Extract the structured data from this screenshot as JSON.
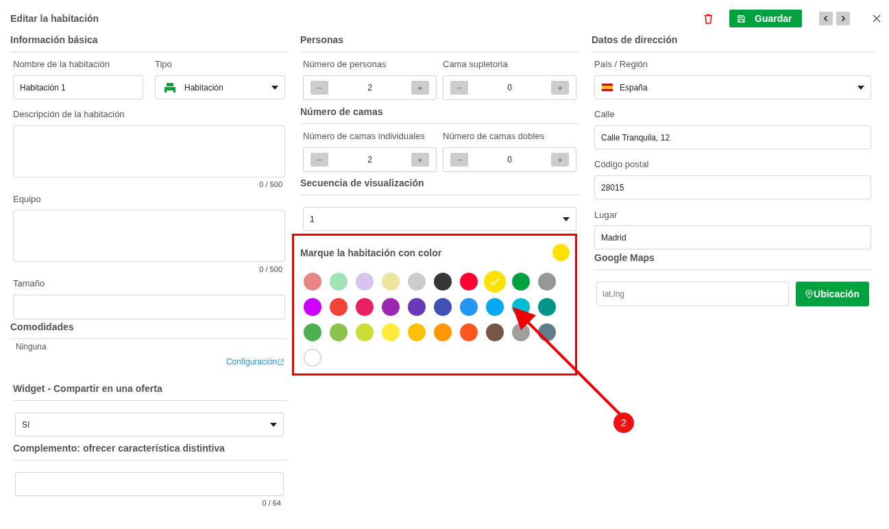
{
  "header": {
    "title": "Editar la habitación",
    "save_button": "Guardar"
  },
  "basic_info": {
    "heading": "Información básica",
    "name": {
      "label": "Nombre de la habitación",
      "value": "Habitación 1"
    },
    "type": {
      "label": "Tipo",
      "value": "Habitación"
    },
    "description": {
      "label": "Descripción de la habitación",
      "counter": "0 / 500"
    },
    "equipment": {
      "label": "Equipo",
      "counter": "0 / 500"
    },
    "size": {
      "label": "Tamaño"
    },
    "amenities": {
      "heading": "Comodidades",
      "value": "Ninguna",
      "link": "Configuración"
    },
    "widget": {
      "heading": "Widget - Compartir en una oferta",
      "value": "Sí"
    },
    "complement": {
      "heading": "Complemento: ofrecer característica distintiva",
      "counter": "0 / 64"
    }
  },
  "people": {
    "heading": "Personas",
    "steppers": [
      {
        "label": "Número de personas",
        "value": "2",
        "minus": "−",
        "plus": "+"
      },
      {
        "label": "Cama supletoria",
        "value": "0",
        "minus": "−",
        "plus": "+"
      }
    ]
  },
  "beds": {
    "heading": "Número de camas",
    "steppers": [
      {
        "label": "Número de camas individuales",
        "value": "2",
        "minus": "−",
        "plus": "+"
      },
      {
        "label": "Número de camas dobles",
        "value": "0",
        "minus": "−",
        "plus": "+"
      }
    ]
  },
  "sequence": {
    "heading": "Secuencia de visualización",
    "value": "1"
  },
  "color_picker": {
    "heading": "Marque la habitación con color",
    "swatches": [
      {
        "color": "#e88585",
        "selected": false
      },
      {
        "color": "#a1e3b7",
        "selected": false
      },
      {
        "color": "#d9c4ef",
        "selected": false
      },
      {
        "color": "#ede59d",
        "selected": false
      },
      {
        "color": "#cccccc",
        "selected": false
      },
      {
        "color": "#363636",
        "selected": false
      },
      {
        "color": "#ff0033",
        "selected": false
      },
      {
        "color": "#ffe100",
        "selected": true
      },
      {
        "color": "#00a23e",
        "selected": false
      },
      {
        "color": "#969696",
        "selected": false
      },
      {
        "color": "#cc00ff",
        "selected": false
      },
      {
        "color": "#f44336",
        "selected": false
      },
      {
        "color": "#e91e63",
        "selected": false
      },
      {
        "color": "#9c27b0",
        "selected": false
      },
      {
        "color": "#673ab7",
        "selected": false
      },
      {
        "color": "#3f51b5",
        "selected": false
      },
      {
        "color": "#2196f3",
        "selected": false
      },
      {
        "color": "#03a9f4",
        "selected": false
      },
      {
        "color": "#00bcd4",
        "selected": false
      },
      {
        "color": "#009688",
        "selected": false
      },
      {
        "color": "#4caf50",
        "selected": false
      },
      {
        "color": "#8bc34a",
        "selected": false
      },
      {
        "color": "#cddc39",
        "selected": false
      },
      {
        "color": "#ffeb3b",
        "selected": false
      },
      {
        "color": "#ffc107",
        "selected": false
      },
      {
        "color": "#ff9800",
        "selected": false
      },
      {
        "color": "#ff5722",
        "selected": false
      },
      {
        "color": "#795548",
        "selected": false
      },
      {
        "color": "#9e9e9e",
        "selected": false
      },
      {
        "color": "#607d8b",
        "selected": false
      },
      {
        "color": "#ffffff",
        "selected": false
      }
    ]
  },
  "address": {
    "heading": "Datos de dirección",
    "country": {
      "label": "País / Región",
      "value": "España"
    },
    "street": {
      "label": "Calle",
      "value": "Calle Tranquila, 12"
    },
    "postal_code": {
      "label": "Código postal",
      "value": "28015"
    },
    "place": {
      "label": "Lugar",
      "value": "Madrid"
    },
    "maps": {
      "heading": "Google Maps",
      "placeholder": "lat,lng",
      "button": "Ubicación"
    }
  },
  "annotation": {
    "badge": "2"
  }
}
